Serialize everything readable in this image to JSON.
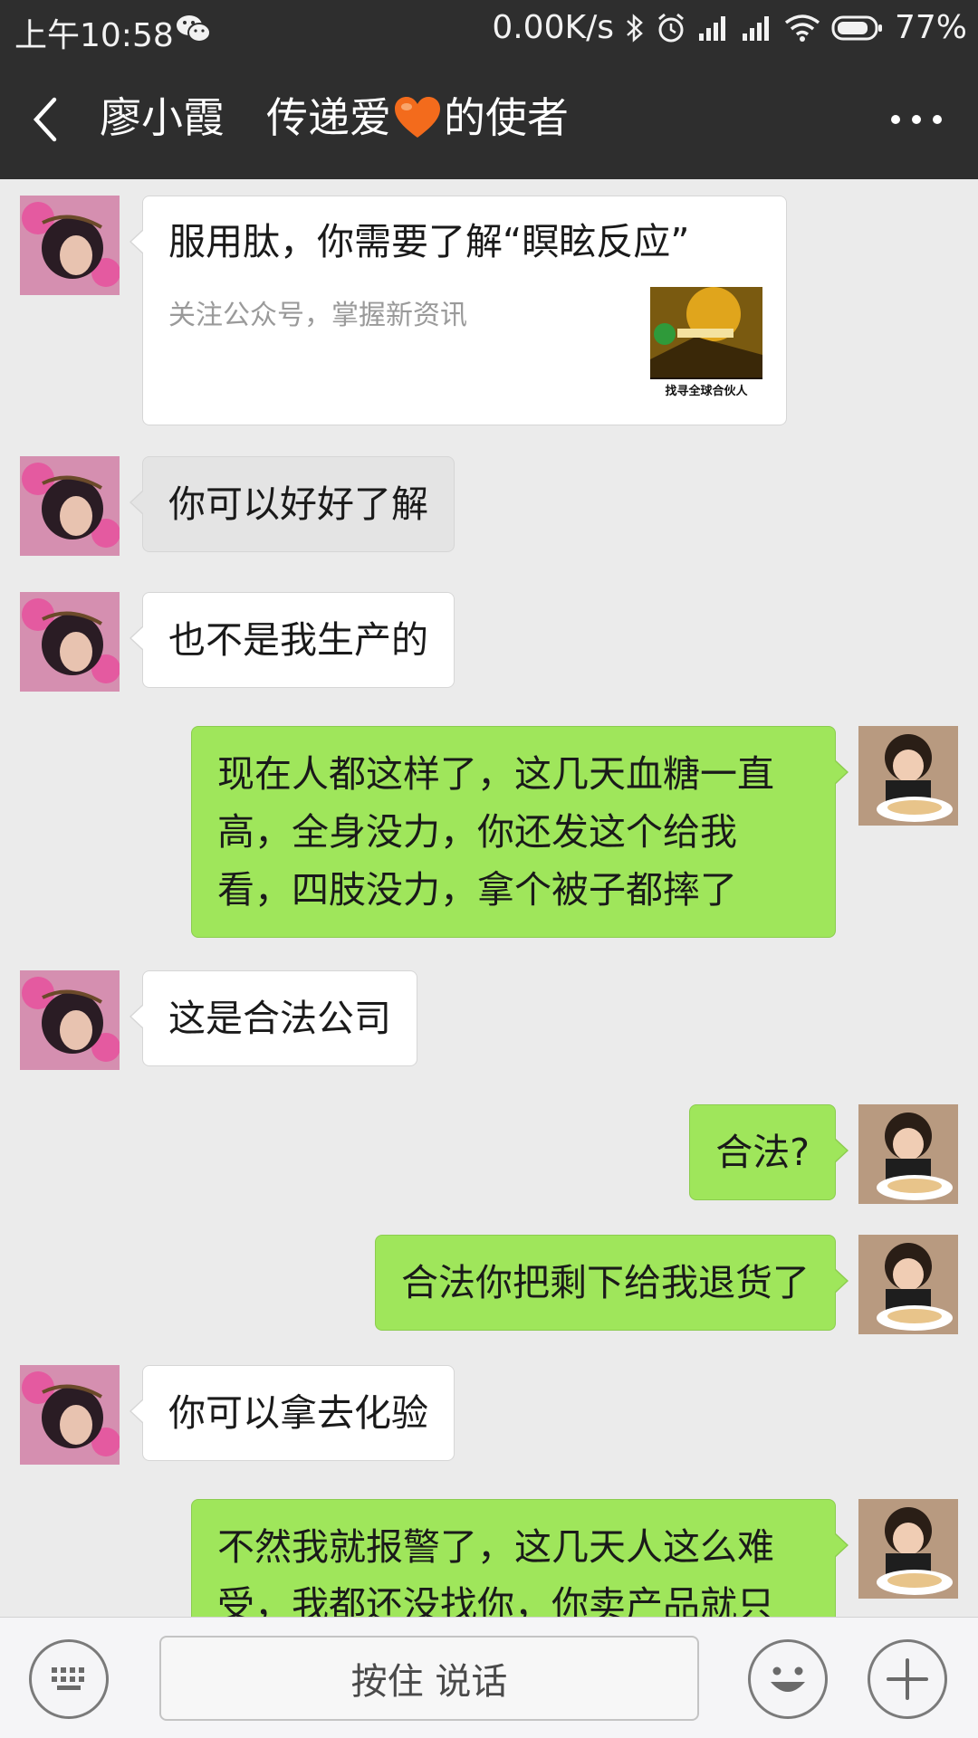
{
  "status_bar": {
    "time": "上午10:58",
    "net_speed": "0.00K/s",
    "battery": "77%",
    "icons": [
      "wechat-icon",
      "bluetooth-icon",
      "alarm-icon",
      "signal-icon",
      "signal-icon",
      "wifi-icon",
      "battery-icon"
    ]
  },
  "header": {
    "title_prefix": "廖小霞　传递爱",
    "title_suffix": "的使者",
    "emoji": "orange-heart-icon",
    "back_icon": "chevron-left-icon",
    "more_icon": "more-dots-icon"
  },
  "messages": [
    {
      "from": "them",
      "type": "card",
      "title": "服用肽，你需要了解“瞑眩反应”",
      "subtitle": "关注公众号，掌握新资讯",
      "thumb_caption": "找寻全球合伙人"
    },
    {
      "from": "them",
      "text": "你可以好好了解"
    },
    {
      "from": "them",
      "text": "也不是我生产的"
    },
    {
      "from": "me",
      "text": "现在人都这样了，这几天血糖一直高，全身没力，你还发这个给我看，四肢没力，拿个被子都摔了"
    },
    {
      "from": "them",
      "text": "这是合法公司"
    },
    {
      "from": "me",
      "text": "合法?"
    },
    {
      "from": "me",
      "text": "合法你把剩下给我退货了"
    },
    {
      "from": "them",
      "text": "你可以拿去化验"
    },
    {
      "from": "me",
      "text": "不然我就报警了，这几天人这么难受，我都还没找你，你卖产品就只"
    }
  ],
  "input_bar": {
    "voice_label": "按住 说话",
    "keyboard_icon": "keyboard-icon",
    "emoji_icon": "emoji-smile-icon",
    "plus_icon": "plus-icon"
  },
  "colors": {
    "header_bg": "#2e2e2e",
    "chat_bg": "#ebebeb",
    "outgoing_bubble": "#9fe65b",
    "incoming_bubble": "#ffffff"
  }
}
